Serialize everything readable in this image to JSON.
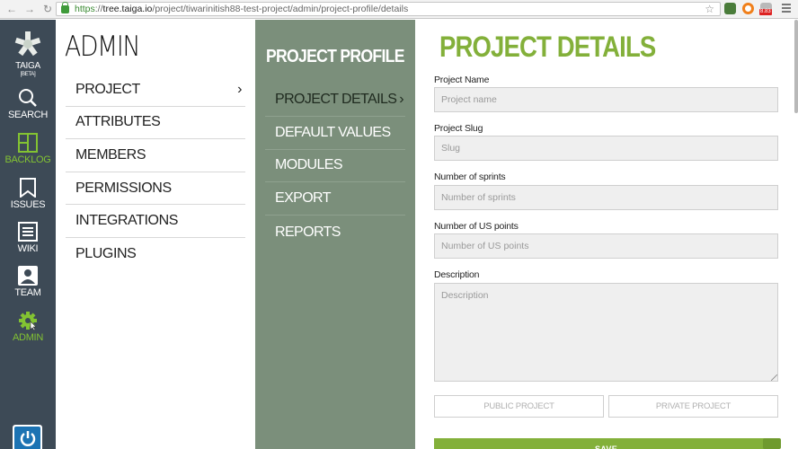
{
  "browser": {
    "url_scheme": "https",
    "url_host": "tree.taiga.io",
    "url_path": "/project/tiwarinitish88-test-project/admin/project-profile/details",
    "extension_badge": "8.83"
  },
  "main_nav": {
    "logo_label": "TAIGA",
    "logo_sub": "[BETA]",
    "items": [
      {
        "label": "SEARCH",
        "icon": "search-icon"
      },
      {
        "label": "BACKLOG",
        "icon": "backlog-icon"
      },
      {
        "label": "ISSUES",
        "icon": "issues-icon"
      },
      {
        "label": "WIKI",
        "icon": "wiki-icon"
      },
      {
        "label": "TEAM",
        "icon": "team-icon"
      },
      {
        "label": "ADMIN",
        "icon": "gear-icon"
      }
    ],
    "active_color": "#83c332"
  },
  "admin": {
    "title": "ADMIN",
    "items": [
      {
        "label": "PROJECT"
      },
      {
        "label": "ATTRIBUTES"
      },
      {
        "label": "MEMBERS"
      },
      {
        "label": "PERMISSIONS"
      },
      {
        "label": "INTEGRATIONS"
      },
      {
        "label": "PLUGINS"
      }
    ],
    "chevron": "›"
  },
  "profile": {
    "title": "PROJECT PROFILE",
    "items": [
      {
        "label": "PROJECT DETAILS"
      },
      {
        "label": "DEFAULT VALUES"
      },
      {
        "label": "MODULES"
      },
      {
        "label": "EXPORT"
      },
      {
        "label": "REPORTS"
      }
    ],
    "chevron": "›"
  },
  "details": {
    "title": "PROJECT DETAILS",
    "fields": {
      "project_name": {
        "label": "Project Name",
        "placeholder": "Project name",
        "value": ""
      },
      "project_slug": {
        "label": "Project Slug",
        "placeholder": "Slug",
        "value": ""
      },
      "sprints": {
        "label": "Number of sprints",
        "placeholder": "Number of sprints",
        "value": ""
      },
      "us_points": {
        "label": "Number of US points",
        "placeholder": "Number of US points",
        "value": ""
      },
      "description": {
        "label": "Description",
        "placeholder": "Description",
        "value": ""
      }
    },
    "public_label": "PUBLIC PROJECT",
    "private_label": "PRIVATE PROJECT",
    "save_label": "SAVE",
    "accent_color": "#83b03a"
  }
}
